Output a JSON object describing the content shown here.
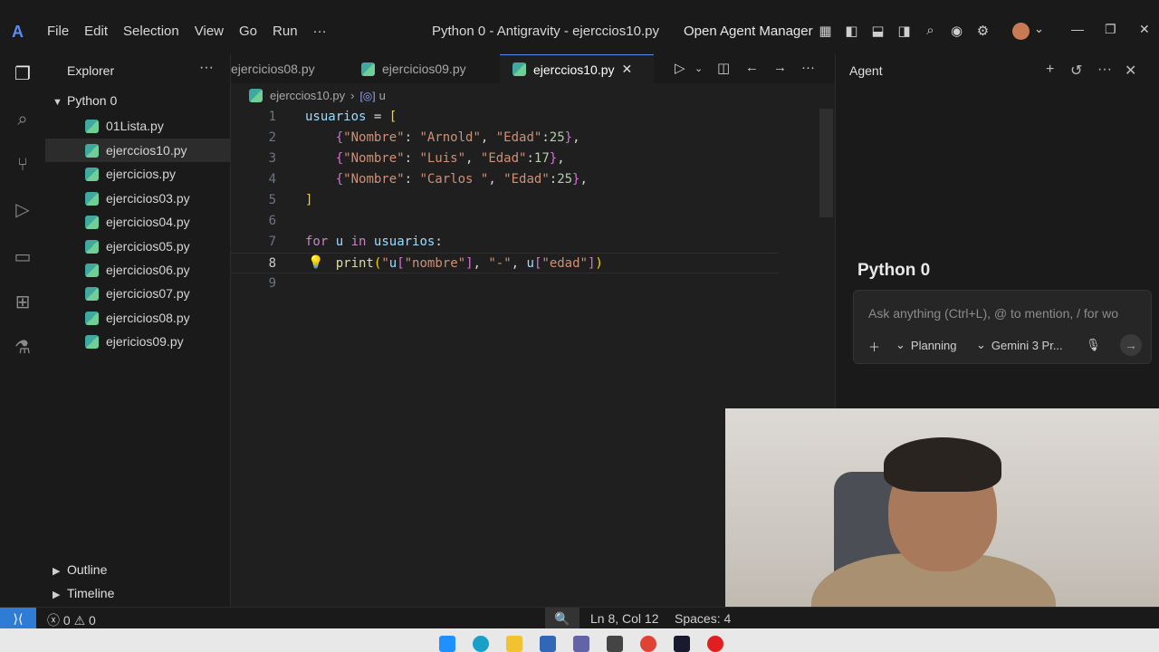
{
  "titlebar": {
    "menu": [
      "File",
      "Edit",
      "Selection",
      "View",
      "Go",
      "Run",
      "···"
    ],
    "window_title": "Python 0 - Antigravity - ejerccios10.py",
    "open_agent_manager": "Open Agent Manager"
  },
  "explorer": {
    "header": "Explorer",
    "folder": "Python 0",
    "files": [
      "01Lista.py",
      "ejerccios10.py",
      "ejercicios.py",
      "ejercicios03.py",
      "ejercicios04.py",
      "ejercicios05.py",
      "ejercicios06.py",
      "ejercicios07.py",
      "ejercicios08.py",
      "ejericios09.py"
    ],
    "selected_index": 1,
    "outline": "Outline",
    "timeline": "Timeline"
  },
  "tabs": [
    {
      "label": "ejercicios08.py",
      "active": false
    },
    {
      "label": "ejercicios09.py",
      "active": false
    },
    {
      "label": "ejerccios10.py",
      "active": true
    }
  ],
  "breadcrumb": {
    "file": "ejerccios10.py",
    "symbol": "u"
  },
  "editor": {
    "lines": [
      {
        "n": "1",
        "text": "usuarios = ["
      },
      {
        "n": "2",
        "text": "{\"Nombre\": \"Arnold\", \"Edad\":25},"
      },
      {
        "n": "3",
        "text": "{\"Nombre\": \"Luis\", \"Edad\":17},"
      },
      {
        "n": "4",
        "text": "{\"Nombre\": \"Carlos \", \"Edad\":25},"
      },
      {
        "n": "5",
        "text": "]"
      },
      {
        "n": "6",
        "text": ""
      },
      {
        "n": "7",
        "text": "for u in usuarios:"
      },
      {
        "n": "8",
        "text": "print(\"u[\"nombre\"], \"-\", u[\"edad\"])"
      },
      {
        "n": "9",
        "text": ""
      }
    ],
    "current_line": 8
  },
  "agent": {
    "title": "Agent",
    "heading": "Python 0",
    "placeholder": "Ask anything (Ctrl+L), @ to mention, / for wo",
    "mode": "Planning",
    "model": "Gemini 3 Pr..."
  },
  "statusbar": {
    "errors": "0",
    "warnings": "0",
    "cursor": "Ln 8, Col 12",
    "spaces": "Spaces: 4"
  }
}
